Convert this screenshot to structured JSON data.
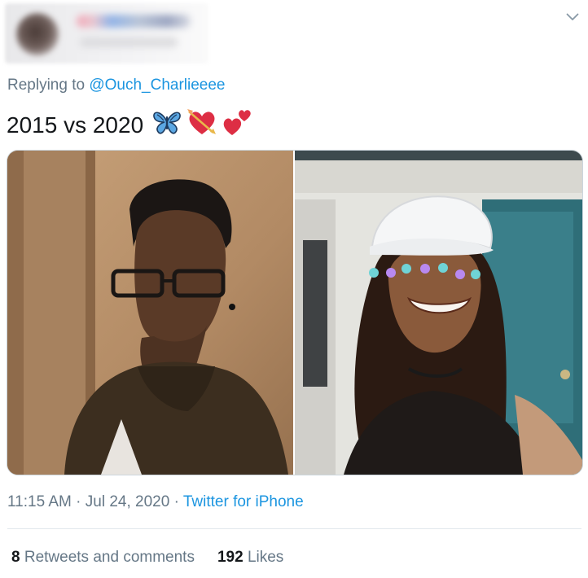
{
  "tweet": {
    "replying_prefix": "Replying to",
    "replying_to": "@Ouch_Charlieeee",
    "text": "2015 vs 2020",
    "emojis": [
      "butterfly-emoji",
      "heart-with-arrow-emoji",
      "two-hearts-emoji"
    ],
    "time": "11:15 AM",
    "date": "Jul 24, 2020",
    "source": "Twitter for iPhone",
    "retweets_count": "8",
    "retweets_label": "Retweets and comments",
    "likes_count": "192",
    "likes_label": "Likes"
  },
  "icons": {
    "menu": "chevron-down-icon"
  },
  "colors": {
    "link": "#1b95e0",
    "muted": "#657786",
    "text": "#14171a",
    "divider": "#e1e8ed"
  }
}
